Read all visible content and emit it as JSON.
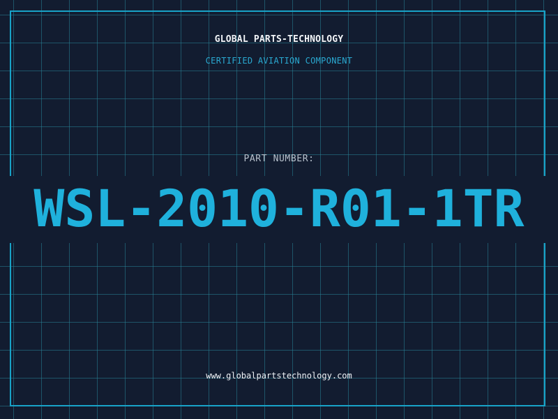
{
  "header": {
    "company": "GLOBAL PARTS-TECHNOLOGY",
    "subtitle": "CERTIFIED AVIATION COMPONENT"
  },
  "part": {
    "label": "PART NUMBER:",
    "number": "WSL-2010-R01-1TR"
  },
  "footer": {
    "website": "www.globalpartstechnology.com"
  },
  "colors": {
    "background": "#121c30",
    "grid": "#1e6a7c",
    "frame": "#18a3c8",
    "accent": "#1fb1dc",
    "label": "#b7c1cc",
    "text": "#f2f5f8"
  }
}
